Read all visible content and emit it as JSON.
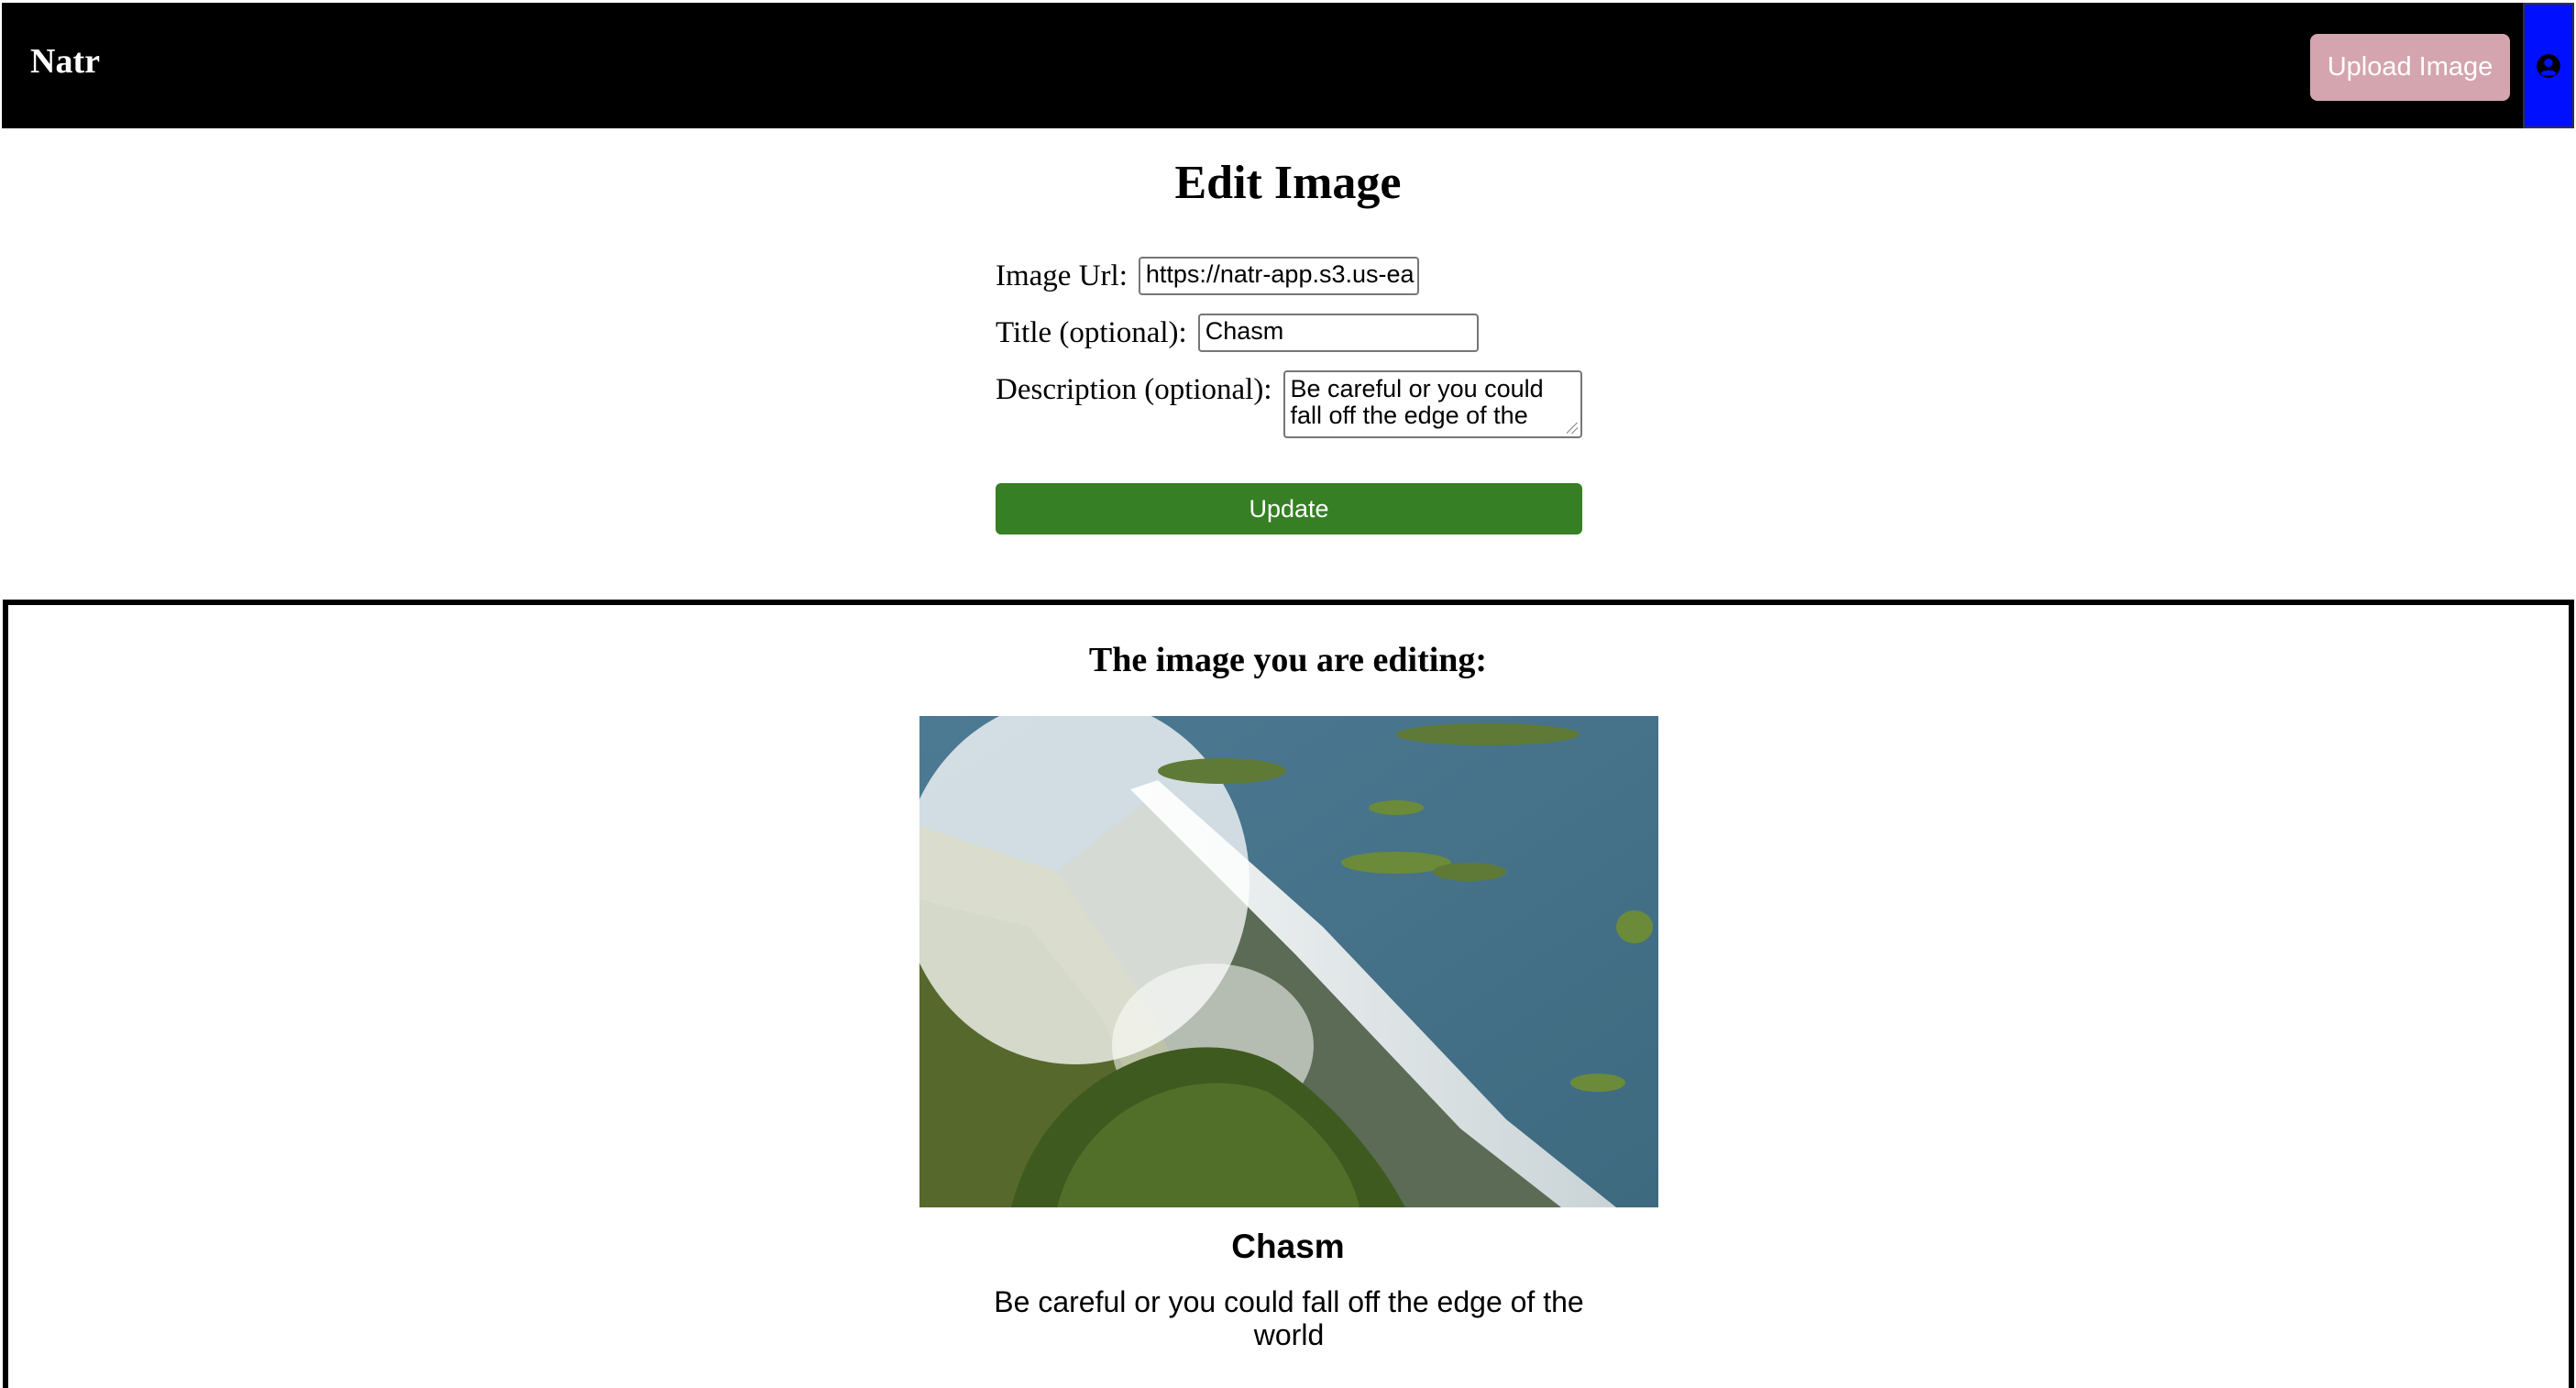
{
  "navbar": {
    "brand": "Natr",
    "upload_button_label": "Upload Image",
    "profile_icon": "user-circle-icon"
  },
  "page": {
    "title": "Edit Image"
  },
  "form": {
    "image_url_label": "Image Url:",
    "image_url_value": "https://natr-app.s3.us-ea",
    "title_label": "Title (optional):",
    "title_value": "Chasm",
    "description_label": "Description (optional):",
    "description_value": "Be careful or you could fall off the edge of the",
    "update_button_label": "Update"
  },
  "preview": {
    "heading": "The image you are editing:",
    "image_title": "Chasm",
    "image_description": "Be careful or you could fall off the edge of the world"
  },
  "colors": {
    "navbar_bg": "#000000",
    "upload_button_bg": "#d4a5ae",
    "profile_button_bg": "#0010ff",
    "update_button_bg": "#367f24"
  }
}
